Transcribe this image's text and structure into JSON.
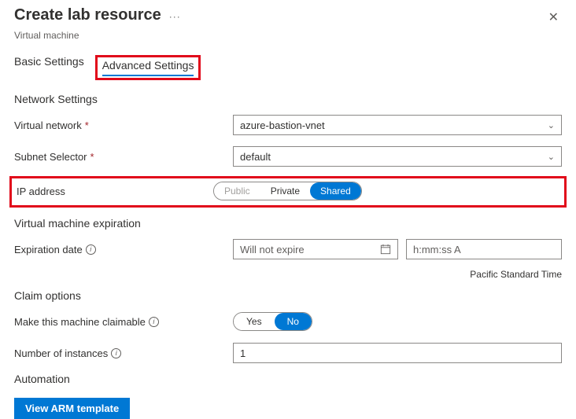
{
  "header": {
    "title": "Create lab resource",
    "subtitle": "Virtual machine"
  },
  "tabs": {
    "basic": "Basic Settings",
    "advanced": "Advanced Settings"
  },
  "network": {
    "section": "Network Settings",
    "vnet_label": "Virtual network",
    "vnet_value": "azure-bastion-vnet",
    "subnet_label": "Subnet Selector",
    "subnet_value": "default",
    "ip_label": "IP address",
    "ip_options": {
      "public": "Public",
      "private": "Private",
      "shared": "Shared"
    }
  },
  "expiration": {
    "section": "Virtual machine expiration",
    "date_label": "Expiration date",
    "date_placeholder": "Will not expire",
    "time_placeholder": "h:mm:ss A",
    "timezone": "Pacific Standard Time"
  },
  "claim": {
    "section": "Claim options",
    "claimable_label": "Make this machine claimable",
    "yes": "Yes",
    "no": "No",
    "instances_label": "Number of instances",
    "instances_value": "1"
  },
  "automation": {
    "section": "Automation",
    "view_arm": "View ARM template"
  }
}
